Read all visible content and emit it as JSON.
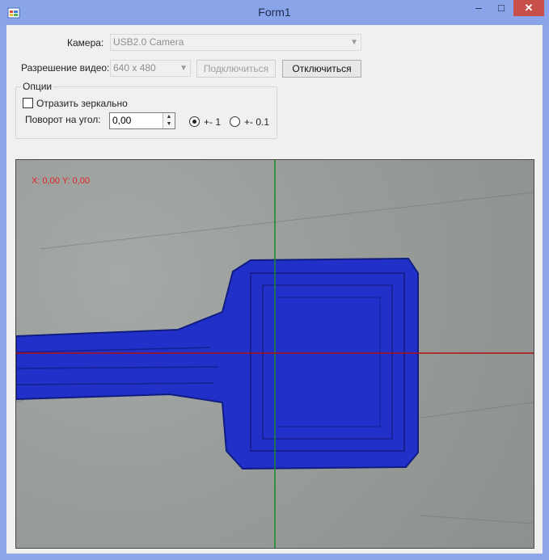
{
  "window": {
    "title": "Form1",
    "min_glyph": "‒",
    "max_glyph": "□",
    "close_glyph": "✕"
  },
  "camera": {
    "label": "Камера:",
    "value": "USB2.0 Camera"
  },
  "resolution": {
    "label": "Разрешение видео:",
    "value": "640 x 480"
  },
  "buttons": {
    "connect": "Подключиться",
    "disconnect": "Отключиться"
  },
  "options": {
    "title": "Опции",
    "mirror_label": "Отразить зеркально",
    "mirror_checked": false,
    "rotate_label": "Поворот на угол:",
    "rotate_value": "0,00",
    "step1_label": "+- 1",
    "step01_label": "+- 0.1",
    "step_selected": "1"
  },
  "video": {
    "coord_text": "X: 0,00 Y: 0,00",
    "crosshair_vertical_color": "#1a8a2a",
    "crosshair_horizontal_color": "#b01010",
    "object_color": "#1f2fcf"
  }
}
